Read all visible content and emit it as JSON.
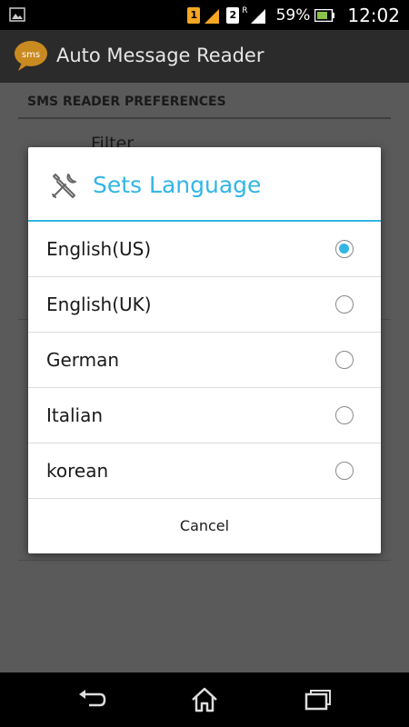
{
  "status_bar": {
    "sim1": "1",
    "sim2": "2",
    "roaming": "R",
    "battery": "59%",
    "time": "12:02",
    "icons": [
      "image-notification-icon",
      "signal-icon",
      "battery-icon"
    ]
  },
  "action_bar": {
    "title": "Auto Message Reader",
    "icon": "sms-app-icon",
    "icon_text": "sms"
  },
  "preferences": {
    "header": "SMS READER PREFERENCES",
    "item": "Filter"
  },
  "dialog": {
    "title": "Sets Language",
    "icon": "tools-icon",
    "accent": "#33b5e5",
    "options": [
      {
        "label": "English(US)",
        "checked": true
      },
      {
        "label": "English(UK)",
        "checked": false
      },
      {
        "label": "German",
        "checked": false
      },
      {
        "label": "Italian",
        "checked": false
      },
      {
        "label": "korean",
        "checked": false
      }
    ],
    "cancel_label": "Cancel"
  },
  "nav_bar": {
    "icons": [
      "back-icon",
      "home-icon",
      "recent-apps-icon"
    ]
  }
}
